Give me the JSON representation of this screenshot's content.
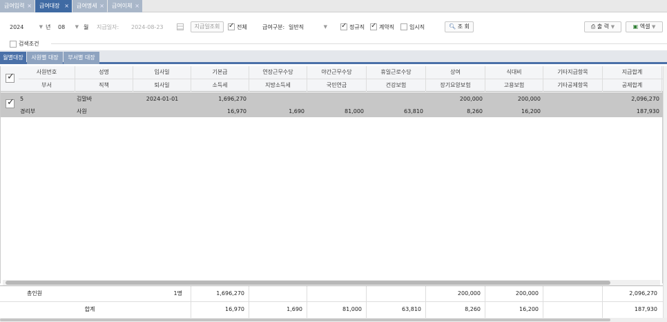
{
  "top_tabs": [
    {
      "label": "급여입력"
    },
    {
      "label": "급여대장"
    },
    {
      "label": "급여명세"
    },
    {
      "label": "급여이체"
    }
  ],
  "filter": {
    "year": "2024",
    "year_unit": "년",
    "month": "08",
    "month_unit": "월",
    "pay_date_label": "지급일자:",
    "pay_date": "2024-08-23",
    "pay_date_search_button": "지급일조회",
    "all_label": "전체",
    "pay_type_label": "급여구분:",
    "pay_type_value": "일반직",
    "regular_label": "정규직",
    "contract_label": "계약직",
    "temporary_label": "임시직",
    "search_button": "조 회",
    "print_button": "출 력",
    "excel_button": "엑셀"
  },
  "search_condition_label": "검색조건",
  "sub_tabs": [
    {
      "label": "월별대장"
    },
    {
      "label": "사원별 대장"
    },
    {
      "label": "부서별 대장"
    }
  ],
  "grid": {
    "header_top": [
      "사원번호",
      "성명",
      "입사일",
      "기본급",
      "연장근무수당",
      "야간근무수당",
      "휴일근로수당",
      "상여",
      "식대비",
      "기타지급항목",
      "지급합계"
    ],
    "header_bottom": [
      "부서",
      "직책",
      "퇴사일",
      "소득세",
      "지방소득세",
      "국민연금",
      "건강보험",
      "장기요양보험",
      "고용보험",
      "기타공제항목",
      "공제합계"
    ],
    "rows": [
      {
        "top": [
          "5",
          "김말바",
          "2024-01-01",
          "1,696,270",
          "",
          "",
          "",
          "200,000",
          "200,000",
          "",
          "2,096,270"
        ],
        "bottom": [
          "경리부",
          "사원",
          "",
          "16,970",
          "1,690",
          "81,000",
          "63,810",
          "8,260",
          "16,200",
          "",
          "187,930"
        ]
      }
    ]
  },
  "footer": {
    "total_people_label": "총인원",
    "total_people_value": "1명",
    "total_label": "합계",
    "top": [
      "1,696,270",
      "",
      "",
      "",
      "200,000",
      "200,000",
      "",
      "2,096,270"
    ],
    "bottom": [
      "16,970",
      "1,690",
      "81,000",
      "63,810",
      "8,260",
      "16,200",
      "",
      "187,930"
    ]
  }
}
